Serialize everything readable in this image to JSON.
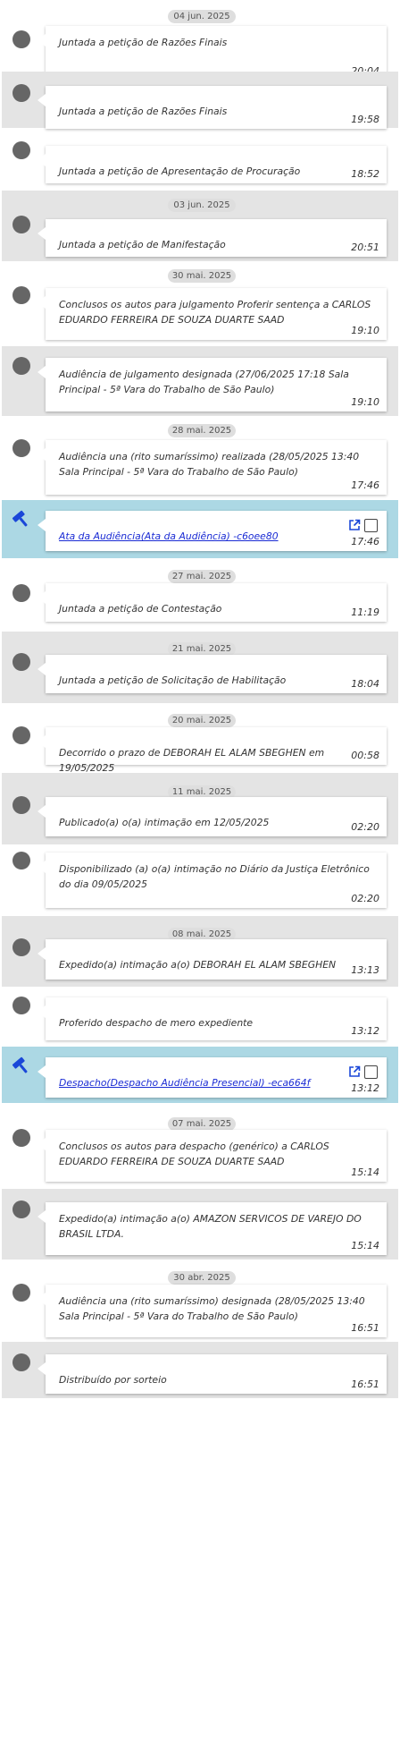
{
  "colors": {
    "doc_band": "#acd8e4",
    "shaded_band": "#e4e4e4",
    "link": "#1a2bd4",
    "dot": "#666666"
  },
  "groups": [
    {
      "date": "04 jun. 2025",
      "events": [
        {
          "text": "Juntada a petição de Razões Finais",
          "time": "20:04"
        },
        {
          "text": "Juntada a petição de Razões Finais",
          "time": "19:58"
        },
        {
          "text": "Juntada a petição de Apresentação de Procuração",
          "time": "18:52"
        }
      ]
    },
    {
      "date": "03 jun. 2025",
      "events": [
        {
          "text": "Juntada a petição de Manifestação",
          "time": "20:51"
        }
      ]
    },
    {
      "date": "30 mai. 2025",
      "events": [
        {
          "text": "Conclusos os autos para julgamento Proferir sentença a CARLOS EDUARDO FERREIRA DE SOUZA DUARTE SAAD",
          "time": "19:10"
        },
        {
          "text": "Audiência de julgamento designada (27/06/2025 17:18 Sala Principal - 5ª Vara do Trabalho de São Paulo)",
          "time": "19:10"
        }
      ]
    },
    {
      "date": "28 mai. 2025",
      "events": [
        {
          "text": "Audiência una (rito sumaríssimo) realizada (28/05/2025 13:40 Sala Principal - 5ª Vara do Trabalho de São Paulo)",
          "time": "17:46"
        },
        {
          "text": "Ata da Audiência(Ata da Audiência) -c6oee80",
          "time": "17:46",
          "document": true
        }
      ]
    },
    {
      "date": "27 mai. 2025",
      "events": [
        {
          "text": "Juntada a petição de Contestação",
          "time": "11:19"
        }
      ]
    },
    {
      "date": "21 mai. 2025",
      "events": [
        {
          "text": "Juntada a petição de Solicitação de Habilitação",
          "time": "18:04"
        }
      ]
    },
    {
      "date": "20 mai. 2025",
      "events": [
        {
          "text": "Decorrido o prazo de DEBORAH EL ALAM SBEGHEN em 19/05/2025",
          "time": "00:58"
        }
      ]
    },
    {
      "date": "11 mai. 2025",
      "events": [
        {
          "text": "Publicado(a) o(a) intimação em 12/05/2025",
          "time": "02:20"
        },
        {
          "text": "Disponibilizado (a) o(a) intimação no Diário da Justiça Eletrônico do dia 09/05/2025",
          "time": "02:20"
        }
      ]
    },
    {
      "date": "08 mai. 2025",
      "events": [
        {
          "text": "Expedido(a) intimação a(o) DEBORAH EL ALAM SBEGHEN",
          "time": "13:13"
        },
        {
          "text": "Proferido despacho de mero expediente",
          "time": "13:12"
        },
        {
          "text": "Despacho(Despacho Audiência Presencial) -eca664f",
          "time": "13:12",
          "document": true
        }
      ]
    },
    {
      "date": "07 mai. 2025",
      "events": [
        {
          "text": "Conclusos os autos para despacho (genérico) a CARLOS EDUARDO FERREIRA DE SOUZA DUARTE SAAD",
          "time": "15:14"
        },
        {
          "text": "Expedido(a) intimação a(o) AMAZON SERVICOS DE VAREJO DO BRASIL LTDA.",
          "time": "15:14"
        }
      ]
    },
    {
      "date": "30 abr. 2025",
      "events": [
        {
          "text": "Audiência una (rito sumaríssimo) designada (28/05/2025 13:40 Sala Principal - 5ª Vara do Trabalho de São Paulo)",
          "time": "16:51"
        },
        {
          "text": "Distribuído por sorteio",
          "time": "16:51"
        }
      ]
    }
  ]
}
